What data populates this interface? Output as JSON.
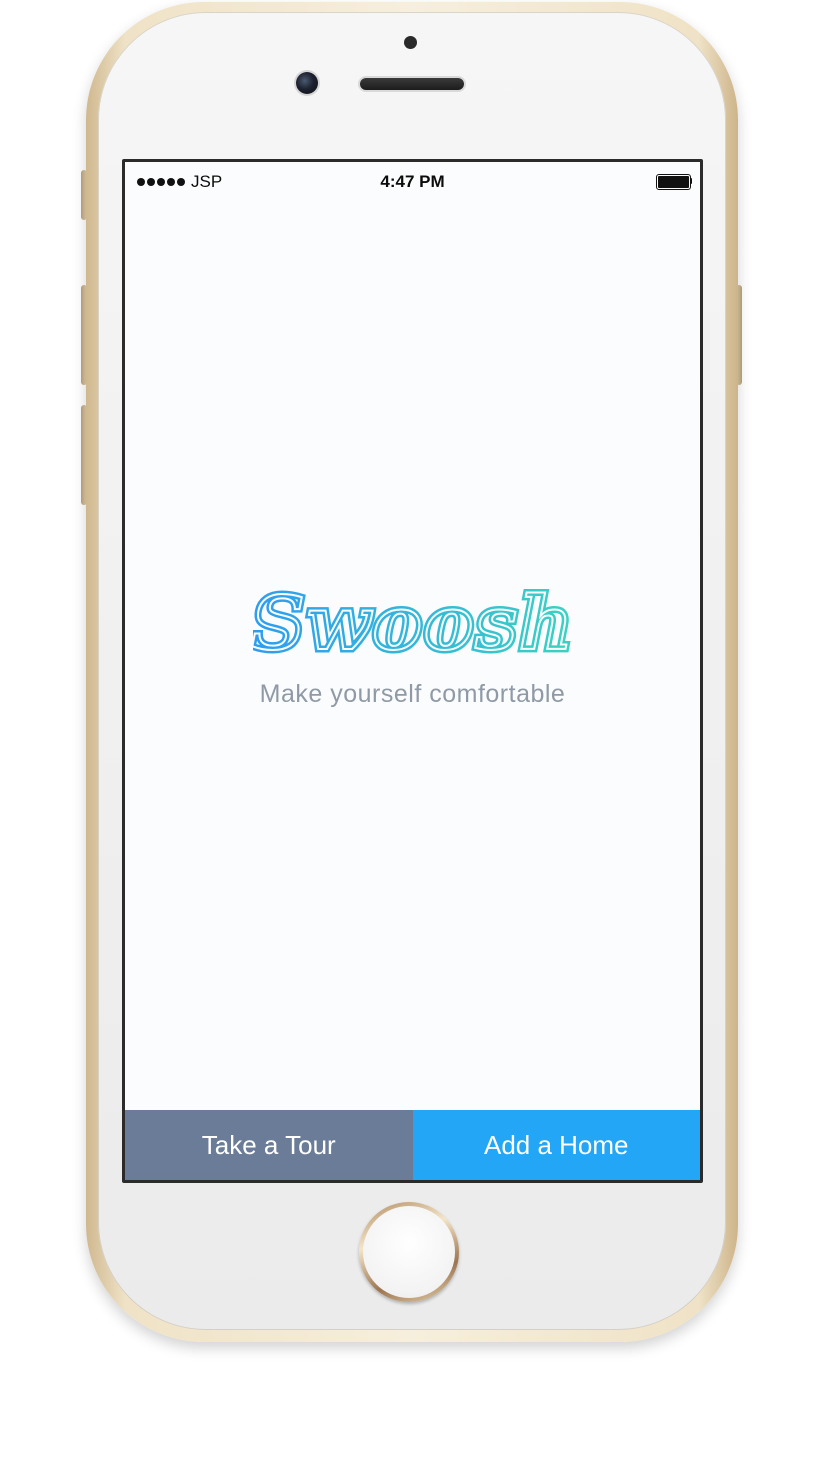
{
  "status_bar": {
    "carrier": "JSP",
    "time": "4:47 PM",
    "signal_bars": 5,
    "battery_level": 1.0
  },
  "splash": {
    "logo_text": "Swoosh",
    "tagline": "Make yourself comfortable"
  },
  "actions": {
    "tour_label": "Take a Tour",
    "add_home_label": "Add a Home"
  },
  "colors": {
    "tour_button": "#6a7c98",
    "add_home_button": "#22a6f5",
    "logo_gradient_start": "#2d9df0",
    "logo_gradient_end": "#3ad2c2",
    "tagline": "#8f9aa6",
    "screen_background": "#fbfcfd"
  },
  "device": {
    "icons": [
      "camera-icon",
      "speaker-icon",
      "signal-icon",
      "battery-icon"
    ]
  }
}
